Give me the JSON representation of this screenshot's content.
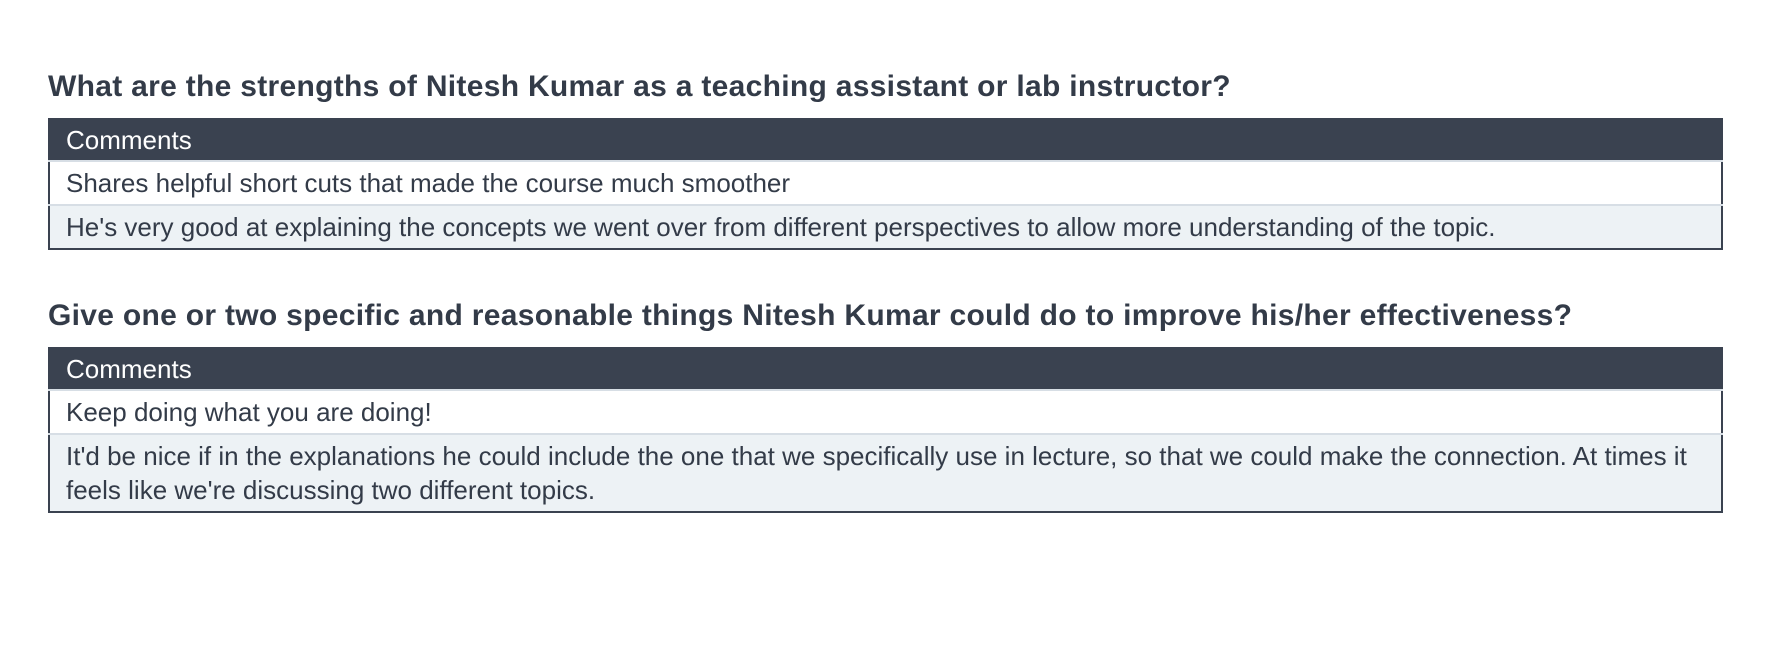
{
  "sections": [
    {
      "question": "What are the strengths of Nitesh Kumar as a teaching assistant or lab instructor?",
      "column_header": "Comments",
      "comments": [
        "Shares helpful short cuts that made the course much smoother",
        "He's very good at explaining the concepts we went over from different perspectives to allow more understanding of the topic."
      ]
    },
    {
      "question": "Give one or two specific and reasonable things Nitesh Kumar could do to improve his/her effectiveness?",
      "column_header": "Comments",
      "comments": [
        "Keep doing what you are doing!",
        "It'd be nice if in the explanations he could include the one that we specifically use in lecture, so that we could make the connection. At times it feels like we're discussing two different topics."
      ]
    }
  ],
  "colors": {
    "text": "#333b48",
    "header_bg": "#3a4250",
    "header_text": "#ffffff",
    "row_alt_bg": "#edf2f5",
    "row_divider": "#d7dee5"
  }
}
